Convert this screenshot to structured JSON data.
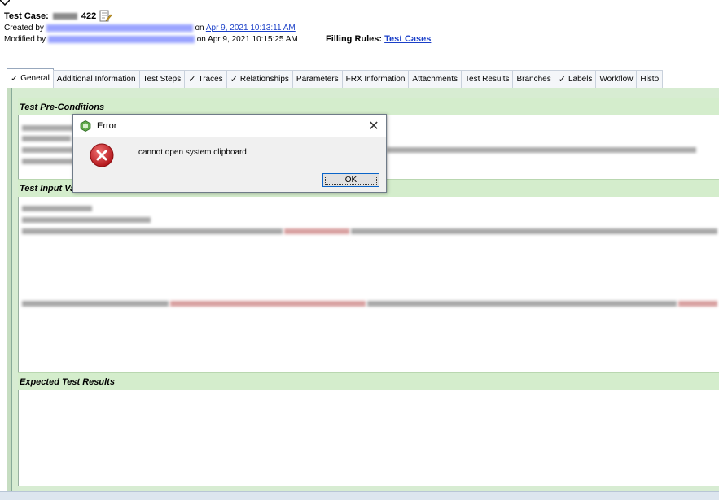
{
  "header": {
    "test_case_label": "Test Case:",
    "test_case_id_suffix": "422",
    "created_prefix": "Created by",
    "created_on_label": "on",
    "created_date": "Apr 9, 2021 10:13:11 AM",
    "modified_prefix": "Modified by",
    "modified_on_label": "on",
    "modified_date": "Apr 9, 2021 10:15:25 AM",
    "filling_rules_label": "Filling Rules:",
    "filling_rules_link": "Test Cases"
  },
  "tabs": [
    {
      "label": "General",
      "checked": true,
      "active": true
    },
    {
      "label": "Additional Information",
      "checked": false
    },
    {
      "label": "Test Steps",
      "checked": false
    },
    {
      "label": "Traces",
      "checked": true
    },
    {
      "label": "Relationships",
      "checked": true
    },
    {
      "label": "Parameters",
      "checked": false
    },
    {
      "label": "FRX Information",
      "checked": false
    },
    {
      "label": "Attachments",
      "checked": false
    },
    {
      "label": "Test Results",
      "checked": false
    },
    {
      "label": "Branches",
      "checked": false
    },
    {
      "label": "Labels",
      "checked": true
    },
    {
      "label": "Workflow",
      "checked": false
    },
    {
      "label": "Histo",
      "checked": false
    }
  ],
  "sections": {
    "preconditions": "Test Pre-Conditions",
    "input_values": "Test Input Values",
    "expected_results": "Expected Test Results"
  },
  "dialog": {
    "title": "Error",
    "message": "cannot open system clipboard",
    "ok_label": "OK",
    "icons": {
      "app": "app-hexagon-icon",
      "error": "error-icon",
      "close": "close-icon"
    }
  },
  "colors": {
    "section_green": "#d4edcc",
    "link_blue": "#1a3fc8",
    "error_red": "#c8262a"
  }
}
